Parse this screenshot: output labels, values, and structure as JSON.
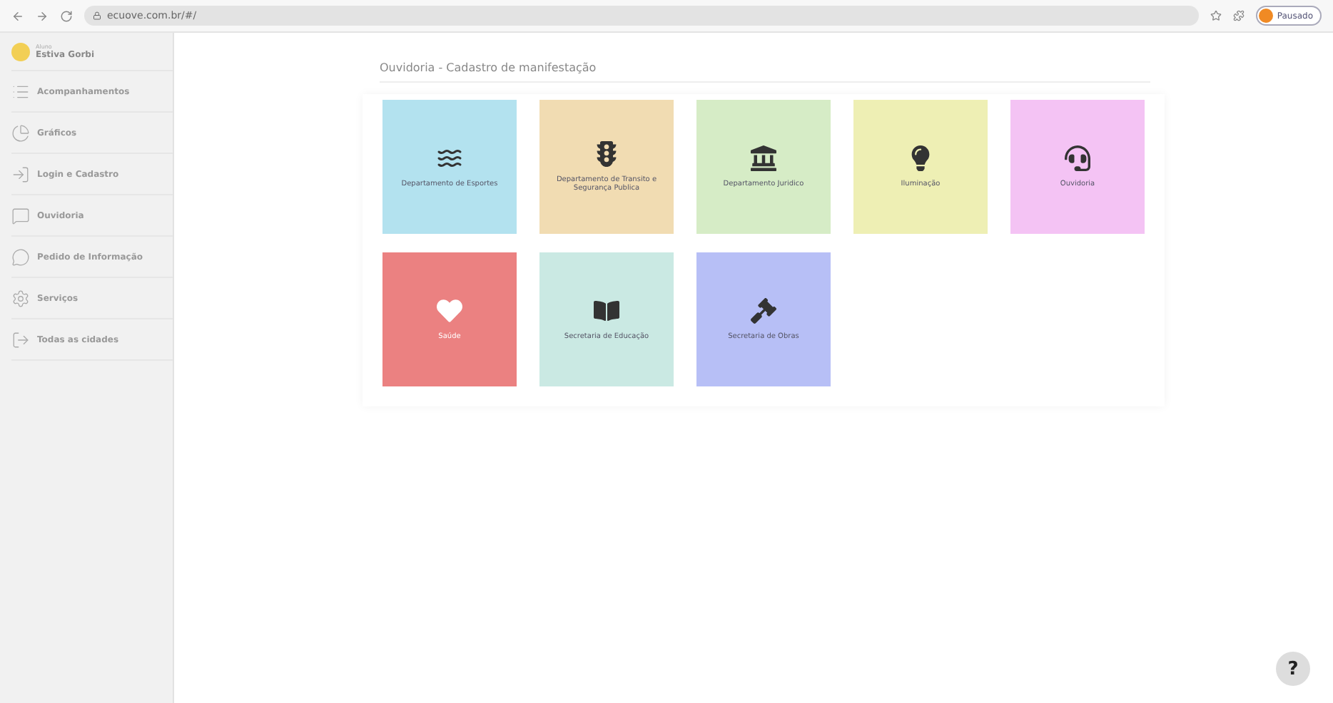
{
  "browser": {
    "url": "ecuove.com.br/#/",
    "profile": "Pausado"
  },
  "sidebar": {
    "user": {
      "role": "Aluno",
      "name": "Estiva Gorbi"
    },
    "items": [
      {
        "label": "Acompanhamentos"
      },
      {
        "label": "Gráficos"
      },
      {
        "label": "Login e Cadastro"
      },
      {
        "label": "Ouvidoria"
      },
      {
        "label": "Pedido de Informação"
      },
      {
        "label": "Serviços"
      },
      {
        "label": "Todas as cidades"
      }
    ]
  },
  "page": {
    "title": "Ouvidoria - Cadastro de manifestação",
    "tiles": [
      {
        "label": "Departamento de Esportes",
        "color": "#b3e2ef"
      },
      {
        "label": "Departamento de Transito e Segurança Publica",
        "color": "#f1dcb2"
      },
      {
        "label": "Departamento Juridico",
        "color": "#d6ecc6"
      },
      {
        "label": "Iluminação",
        "color": "#eeefb4"
      },
      {
        "label": "Ouvidoria",
        "color": "#f4c3f4"
      },
      {
        "label": "Saúde",
        "color": "#eb8181"
      },
      {
        "label": "Secretaria de Educação",
        "color": "#cae9e3"
      },
      {
        "label": "Secretaria de Obras",
        "color": "#b7bff6"
      }
    ]
  },
  "help": "?"
}
